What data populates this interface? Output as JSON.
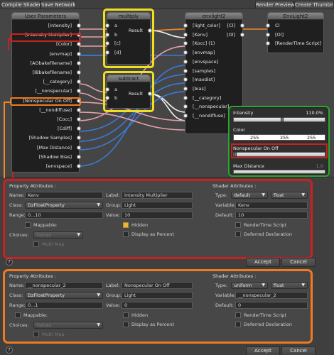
{
  "toolbar": {
    "compile_shader": "Compile Shader",
    "save_network": "Save Network",
    "render_preview": "Render Preview",
    "create_thumbnail": "Create Thumbnai"
  },
  "nodes": {
    "user_parameters": {
      "title": "User Parameters",
      "ports": [
        "[Intensity]",
        "[Intensity Multiplier]",
        "[Color]",
        "[envmap]",
        "[AObakefilename]",
        "[IBbakefilename]",
        "[__category]",
        "[__nonspecular]",
        "[Nonspecular On  Off]",
        "[__nondiffuse]",
        "[Cocc]",
        "[Cdiff]",
        "[Shadow Samples]",
        "[Max Distance]",
        "[Shadow Bias]",
        "[envspace]"
      ]
    },
    "multiply": {
      "title": "multiply",
      "inputs": [
        "a",
        "b",
        "[c]",
        "[d]"
      ],
      "output": "Result"
    },
    "subtract": {
      "title": "subtract",
      "inputs": [
        "a",
        "b"
      ],
      "output": "Result"
    },
    "envlight2_node": {
      "title": "envlight2",
      "inputs": [
        "[light_color]",
        "[Kenv]",
        "[Kocc] (1)",
        "[envmap]",
        "[envspace]",
        "[samples]",
        "[maxdist]",
        "[bias]",
        "[__category]",
        "[__nonspecular]",
        "[__nondiffuse]"
      ],
      "outputs": [
        "[Cl]",
        "[Ol]"
      ]
    },
    "envlight2_out": {
      "title": "EnvLight2",
      "inputs": [
        "Cl",
        "[Ol]",
        "[RenderTime Script]"
      ]
    }
  },
  "param_panel": {
    "intensity_label": "Intensity",
    "intensity_value": "110.0%",
    "intensity_level": 0.52,
    "color_label": "Color",
    "color_values": [
      "255",
      "255",
      "255"
    ],
    "nonspec_label": "Nonspecular On  Off",
    "nonspec_level": 0.0,
    "maxdist_label": "Max Distance",
    "maxdist_value": "1.0"
  },
  "labels": {
    "property_attributes": "Property Attributes :",
    "shader_attributes": "Shader Attributes :",
    "name": "Name:",
    "class": "Class:",
    "range": "Range:",
    "mappable": "Mappable:",
    "choices": "Choices:",
    "label": "Label:",
    "group": "Group:",
    "value": "Value:",
    "hidden": "Hidden",
    "display_percent": "Display as Percent",
    "type": "Type:",
    "variable": "Variable:",
    "default": "Default:",
    "rendertime_script": "RenderTime Script",
    "deferred_declaration": "Deferred Declaration",
    "accept": "Accept",
    "cancel": "Cancel",
    "help": "?",
    "multi_map": "Multi Map",
    "ghost_choice": "Values"
  },
  "panel1": {
    "name": "Kenv",
    "class": "DzFloatProperty",
    "range": "0...10",
    "label": "Intensity Multiplier",
    "group": "Light",
    "value": "10",
    "hidden_checked": true,
    "type": "default",
    "type2": "float",
    "variable": "Kenv",
    "default": "10"
  },
  "panel2": {
    "name": "__nonspecular_2",
    "class": "DzFloatProperty",
    "range": "0...1",
    "label": "Nonspecular On  Off",
    "group": "Light",
    "value": "0",
    "hidden_checked": false,
    "type": "uniform",
    "type2": "float",
    "variable": "__nonspecular_2",
    "default": "0"
  },
  "colors": {
    "highlight_yellow": "#f0e020",
    "highlight_red": "#cc2020",
    "highlight_orange": "#f07a20",
    "highlight_green": "#2aa830",
    "wire_orange": "#f08a28",
    "wire_blue": "#3a7ad8",
    "wire_pink": "#e6a0a8",
    "wire_white": "#f0f0f0"
  }
}
